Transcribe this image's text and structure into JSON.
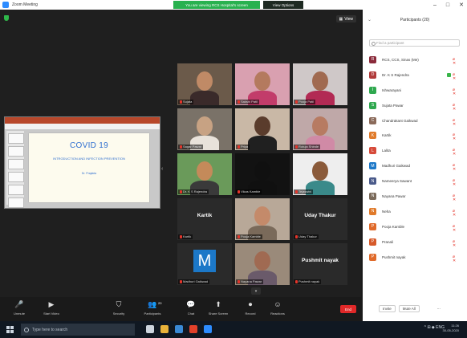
{
  "window": {
    "title": "Zoom Meeting",
    "controls": [
      "–",
      "□",
      "✕"
    ]
  },
  "banner": {
    "message": "You are viewing RCS Hospital's screen",
    "button": "View Options"
  },
  "meeting": {
    "view_label": "View",
    "slide": {
      "title": "COVID 19",
      "subtitle": "INTRODUCTION AND INFECTION PREVENTION",
      "signature": "Dr. Prajakta"
    },
    "tiles": [
      {
        "name": "Sujata",
        "kind": "photo",
        "bg": "#6b5a4a",
        "skin": "#c08a66",
        "shirt": "#3a2a2a"
      },
      {
        "name": "Sakshi Patil",
        "kind": "photo",
        "bg": "#d9a0b0",
        "skin": "#b47a5e",
        "shirt": "#c23c6a"
      },
      {
        "name": "Pooja Patil",
        "kind": "photo",
        "bg": "#cfc8c8",
        "skin": "#a06a50",
        "shirt": "#b22a54"
      },
      {
        "name": "Sagar Pawar",
        "kind": "photo",
        "bg": "#7a7268",
        "skin": "#c7a283",
        "shirt": "#e8e2da"
      },
      {
        "name": "Priya",
        "kind": "photo",
        "bg": "#c9b8a6",
        "skin": "#5a3c2c",
        "shirt": "#202020"
      },
      {
        "name": "Rutuja Shinde",
        "kind": "photo",
        "bg": "#bfa8a8",
        "skin": "#b77b62",
        "shirt": "#d08aa6"
      },
      {
        "name": "Dr. K S Rajendra",
        "kind": "photo",
        "bg": "#6a9a5a",
        "skin": "#c48a5a",
        "shirt": "#3a3a3a"
      },
      {
        "name": "Vikas Kamble",
        "kind": "photo",
        "bg": "#121212",
        "skin": "#101010",
        "shirt": "#101010"
      },
      {
        "name": "Tejaswini",
        "kind": "photo",
        "bg": "#eeeeee",
        "skin": "#8a5a3a",
        "shirt": "#3a8a8a"
      },
      {
        "name": "Kartik",
        "kind": "name",
        "label": "Kartik"
      },
      {
        "name": "Pooja Kamble",
        "kind": "photo",
        "bg": "#b8a898",
        "skin": "#c48a6a",
        "shirt": "#7a6a5a"
      },
      {
        "name": "Uday Thakur",
        "kind": "name",
        "label": "Uday Thakur"
      },
      {
        "name": "Madhuri Gaikwad",
        "kind": "avatar",
        "label": "M"
      },
      {
        "name": "Nayana Pawar",
        "kind": "photo",
        "bg": "#9a8a7a",
        "skin": "#a06a52",
        "shirt": "#6a5a6a"
      },
      {
        "name": "Pushmit nayak",
        "kind": "name",
        "label": "Pushmit nayak"
      }
    ]
  },
  "toolbar": {
    "items": [
      {
        "name": "mute-button",
        "label": "Unmute",
        "icon": "🎤"
      },
      {
        "name": "video-button",
        "label": "Start Video",
        "icon": "▶"
      },
      {
        "name": "security-button",
        "label": "Security",
        "icon": "⛉"
      },
      {
        "name": "participants-button",
        "label": "Participants",
        "icon": "👥",
        "count": "20"
      },
      {
        "name": "chat-button",
        "label": "Chat",
        "icon": "💬"
      },
      {
        "name": "share-screen-button",
        "label": "Share Screen",
        "icon": "⬆"
      },
      {
        "name": "record-button",
        "label": "Record",
        "icon": "⏺"
      },
      {
        "name": "reactions-button",
        "label": "Reactions",
        "icon": "☺"
      }
    ],
    "end_label": "End"
  },
  "panel": {
    "title": "Participants (20)",
    "search_placeholder": "Find a participant",
    "participants": [
      {
        "name": "RCS, CCS, Sinas (Me)",
        "avatar": "R",
        "color": "#8a2a3a",
        "status": "muted"
      },
      {
        "name": "Dr. K S Rajendra",
        "avatar": "D",
        "color": "#b03a3a",
        "status": "video"
      },
      {
        "name": "Ishwarayani",
        "avatar": "I",
        "color": "#2fa84f",
        "status": "muted"
      },
      {
        "name": "Sujata Pawar",
        "avatar": "S",
        "color": "#2fa84f",
        "status": "muted"
      },
      {
        "name": "Chandrakant Gaikwad",
        "avatar": "C",
        "color": "#8a6a5a",
        "status": "muted"
      },
      {
        "name": "Kartik",
        "avatar": "K",
        "color": "#e07a2a",
        "status": "muted"
      },
      {
        "name": "Lalita",
        "avatar": "L",
        "color": "#d64a3a",
        "status": "muted"
      },
      {
        "name": "Madhuri Gaikwad",
        "avatar": "M",
        "color": "#1c78c8",
        "status": "muted"
      },
      {
        "name": "Nameerya Sawant",
        "avatar": "N",
        "color": "#4a5a8a",
        "status": "muted"
      },
      {
        "name": "Nayana Pawar",
        "avatar": "N",
        "color": "#7a6a5a",
        "status": "muted"
      },
      {
        "name": "Neha",
        "avatar": "N",
        "color": "#e07a2a",
        "status": "muted"
      },
      {
        "name": "Pooja Kamble",
        "avatar": "P",
        "color": "#e06a2a",
        "status": "muted"
      },
      {
        "name": "Pranali",
        "avatar": "P",
        "color": "#d65a2a",
        "status": "muted"
      },
      {
        "name": "Pushmit nayak",
        "avatar": "P",
        "color": "#e06a2a",
        "status": "muted"
      }
    ],
    "footer": {
      "invite": "Invite",
      "mute_all": "Mute All",
      "more": "..."
    }
  },
  "taskbar": {
    "search_placeholder": "Type here to search",
    "apps": [
      {
        "name": "task-view-icon",
        "color": "#cdd5de"
      },
      {
        "name": "file-explorer-icon",
        "color": "#e8b23a"
      },
      {
        "name": "store-icon",
        "color": "#3a8ad6"
      },
      {
        "name": "chrome-icon",
        "color": "#e0402a"
      },
      {
        "name": "zoom-icon",
        "color": "#2d8cff"
      }
    ],
    "tray": "^  ⊞  ◆  ENG",
    "time": "11:26",
    "date": "30-05-2020"
  }
}
